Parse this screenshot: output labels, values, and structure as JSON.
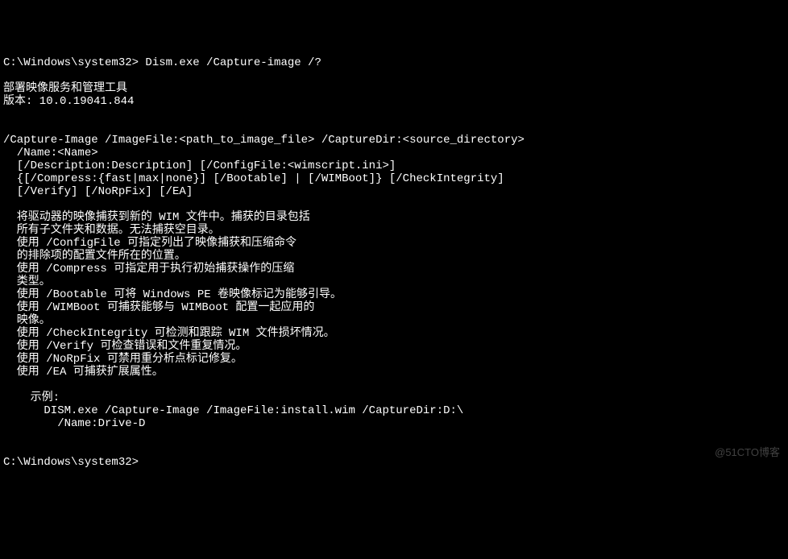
{
  "prompt1": "C:\\Windows\\system32> Dism.exe /Capture-image /?",
  "blank": "",
  "line1": "部署映像服务和管理工具",
  "line2": "版本: 10.0.19041.844",
  "line3": "/Capture-Image /ImageFile:<path_to_image_file> /CaptureDir:<source_directory>",
  "line4": "  /Name:<Name>",
  "line5": "  [/Description:Description] [/ConfigFile:<wimscript.ini>]",
  "line6": "  {[/Compress:{fast|max|none}] [/Bootable] | [/WIMBoot]} [/CheckIntegrity]",
  "line7": "  [/Verify] [/NoRpFix] [/EA]",
  "line8": "  将驱动器的映像捕获到新的 WIM 文件中。捕获的目录包括",
  "line9": "  所有子文件夹和数据。无法捕获空目录。",
  "line10": "  使用 /ConfigFile 可指定列出了映像捕获和压缩命令",
  "line11": "  的排除项的配置文件所在的位置。",
  "line12": "  使用 /Compress 可指定用于执行初始捕获操作的压缩",
  "line13": "  类型。",
  "line14": "  使用 /Bootable 可将 Windows PE 卷映像标记为能够引导。",
  "line15": "  使用 /WIMBoot 可捕获能够与 WIMBoot 配置一起应用的",
  "line16": "  映像。",
  "line17": "  使用 /CheckIntegrity 可检测和跟踪 WIM 文件损坏情况。",
  "line18": "  使用 /Verify 可检查错误和文件重复情况。",
  "line19": "  使用 /NoRpFix 可禁用重分析点标记修复。",
  "line20": "  使用 /EA 可捕获扩展属性。",
  "line21": "    示例:",
  "line22": "      DISM.exe /Capture-Image /ImageFile:install.wim /CaptureDir:D:\\",
  "line23": "        /Name:Drive-D",
  "prompt2": "C:\\Windows\\system32> ",
  "watermark": "@51CTO博客"
}
